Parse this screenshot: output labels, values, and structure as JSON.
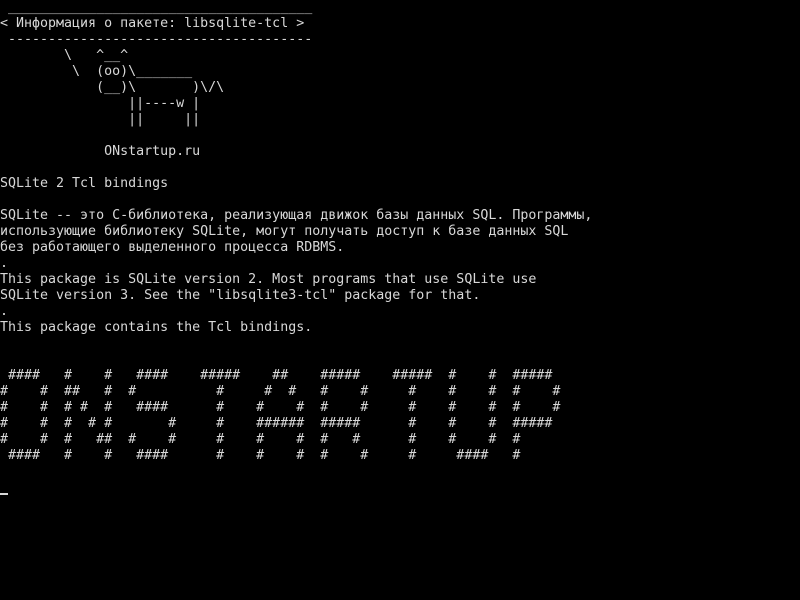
{
  "cowsay": {
    "lines": [
      " ______________________________________",
      "< Информация о пакете: libsqlite-tcl >",
      " --------------------------------------",
      "        \\   ^__^",
      "         \\  (oo)\\_______",
      "            (__)\\       )\\/\\",
      "                ||----w |",
      "                ||     ||",
      "",
      "             ONstartup.ru"
    ]
  },
  "description": {
    "lines": [
      "SQLite 2 Tcl bindings",
      "",
      "SQLite -- это C-библиотека, реализующая движок базы данных SQL. Программы,",
      "использующие библиотеку SQLite, могут получать доступ к базе данных SQL",
      "без работающего выделенного процесса RDBMS.",
      ".",
      "This package is SQLite version 2. Most programs that use SQLite use",
      "SQLite version 3. See the \"libsqlite3-tcl\" package for that.",
      ".",
      "This package contains the Tcl bindings."
    ]
  },
  "banner": {
    "lines": [
      " ####   #    #   ####    #####    ##    #####    #####  #    #  #####",
      "#    #  ##   #  #          #     #  #   #    #     #    #    #  #    #",
      "#    #  # #  #   ####      #    #    #  #    #     #    #    #  #    #",
      "#    #  #  # #       #     #    ######  #####      #    #    #  #####",
      "#    #  #   ##  #    #     #    #    #  #   #      #    #    #  #",
      " ####   #    #   ####      #    #    #  #    #     #     ####   #"
    ]
  }
}
